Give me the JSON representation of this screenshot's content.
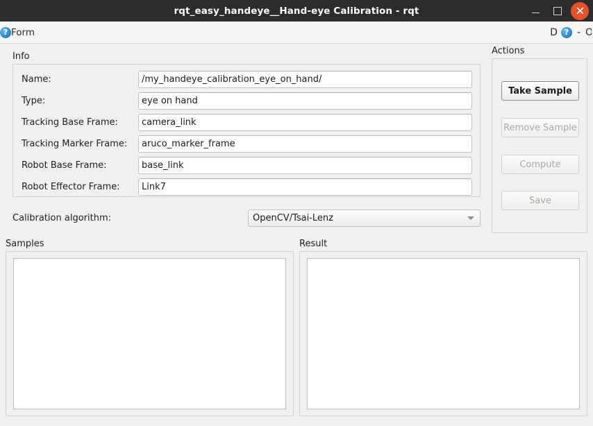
{
  "window": {
    "title": "rqt_easy_handeye__Hand-eye Calibration - rqt",
    "controls": {
      "minimize": "minimize-button",
      "maximize": "maximize-button",
      "close": "close-button"
    },
    "colors": {
      "titlebar_bg": "#2c2c2c",
      "close_button": "#e8512b",
      "window_bg": "#f0f0f0",
      "help_icon": "#2f8fd4"
    }
  },
  "toolbar": {
    "help_icon_glyph": "?",
    "form_label": "Form",
    "right_letter": "D",
    "right_dash": "-",
    "right_clipped": "O"
  },
  "info": {
    "title": "Info",
    "fields": [
      {
        "label": "Name:",
        "value": "/my_handeye_calibration_eye_on_hand/"
      },
      {
        "label": "Type:",
        "value": "eye on hand"
      },
      {
        "label": "Tracking Base Frame:",
        "value": "camera_link"
      },
      {
        "label": "Tracking Marker Frame:",
        "value": "aruco_marker_frame"
      },
      {
        "label": "Robot Base Frame:",
        "value": "base_link"
      },
      {
        "label": "Robot Effector Frame:",
        "value": "Link7"
      }
    ]
  },
  "algorithm": {
    "label": "Calibration algorithm:",
    "selected": "OpenCV/Tsai-Lenz"
  },
  "samples": {
    "title": "Samples",
    "items": []
  },
  "result": {
    "title": "Result",
    "items": []
  },
  "actions": {
    "title": "Actions",
    "buttons": [
      {
        "label": "Take Sample",
        "enabled": true
      },
      {
        "label": "Remove Sample",
        "enabled": false
      },
      {
        "label": "Compute",
        "enabled": false
      },
      {
        "label": "Save",
        "enabled": false
      }
    ]
  }
}
